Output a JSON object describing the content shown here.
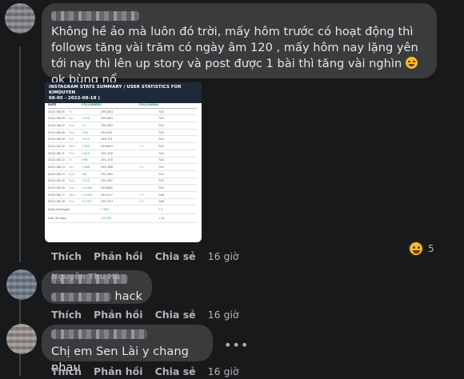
{
  "comment1": {
    "author": "",
    "text": "Không hề ảo mà luôn đó trời, mấy hôm trước có hoạt động thì follows tăng vài trăm có ngày âm 120 , mấy hôm nay lặng yên tới nay thì lên up story và post được 1 bài thì tăng vài nghìn",
    "text_end": " ok bùng nổ",
    "emoji_icon": "laughing-face-icon",
    "attachment": {
      "title": "INSTAGRAM STATS SUMMARY / USER STATISTICS FOR KIMDUYEN",
      "subtitle": "08-05 - 2022-08-18 )",
      "headers": [
        "DATE",
        "",
        "FOLLOWERS",
        "",
        "FOLLOWING",
        ""
      ],
      "rows": [
        [
          "2022-08-05",
          "Fri",
          "",
          "290,284",
          "",
          "740"
        ],
        [
          "2022-08-06",
          "Sat",
          "+374",
          "290,464",
          "",
          "740"
        ],
        [
          "2022-08-07",
          "Sun",
          "+1",
          "290,463",
          "",
          "740"
        ],
        [
          "2022-08-08",
          "Mon",
          "+56",
          "290,001",
          "",
          "740"
        ],
        [
          "2022-08-09",
          "Tue",
          "+211",
          "290,701",
          "",
          "740"
        ],
        [
          "2022-08-10",
          "Wed",
          "+102",
          "290,803",
          "+1",
          "744"
        ],
        [
          "2022-08-11",
          "Thu",
          "+423",
          "291,226",
          "",
          "744"
        ],
        [
          "2022-08-12",
          "Fri",
          "+98",
          "291,100",
          "",
          "744"
        ],
        [
          "2022-08-13",
          "Sat",
          "+166",
          "291,266",
          "+1",
          "745"
        ],
        [
          "2022-08-14",
          "Sun",
          "-96",
          "291,180",
          "",
          "745"
        ],
        [
          "2022-08-15",
          "Mon",
          "+112",
          "291,287",
          "",
          "745"
        ],
        [
          "2022-08-16",
          "Tue",
          "+2,005",
          "293,882",
          "",
          "745"
        ],
        [
          "2022-08-17",
          "Wed",
          "+1,447",
          "294,317",
          "+1",
          "746"
        ],
        [
          "2022-08-18",
          "Thu",
          "+1,377",
          "295,754",
          "+1",
          "746"
        ]
      ],
      "summary": [
        [
          "Daily Averages",
          "+180",
          "+1"
        ],
        [
          "Last 30 days",
          "+5,501",
          "+10"
        ]
      ]
    },
    "reaction_icon": "haha-reaction-icon",
    "reaction_count": "5",
    "actions": {
      "like": "Thích",
      "reply": "Phản hồi",
      "share": "Chia sẻ",
      "time": "16 giờ"
    }
  },
  "comment2": {
    "author": "Nguyễn Thu Hà",
    "text_suffix": "hack",
    "actions": {
      "like": "Thích",
      "reply": "Phản hồi",
      "share": "Chia sẻ",
      "time": "16 giờ"
    }
  },
  "comment3": {
    "author": "",
    "text": "Chị em Sen Lài y chang nhau",
    "more_icon": "more-options-icon",
    "more_label": "•••",
    "actions": {
      "like": "Thích",
      "reply": "Phản hồi",
      "share": "Chia sẻ",
      "time": "16 giờ"
    }
  }
}
